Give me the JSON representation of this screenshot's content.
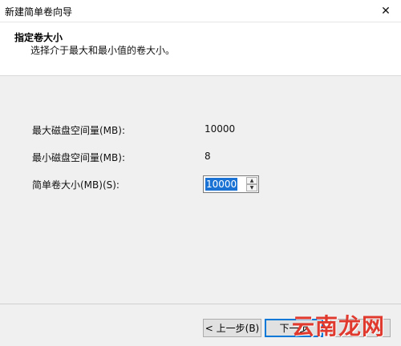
{
  "window": {
    "title": "新建简单卷向导",
    "close_glyph": "✕"
  },
  "header": {
    "step_title": "指定卷大小",
    "step_desc": "选择介于最大和最小值的卷大小。"
  },
  "fields": {
    "max_label": "最大磁盘空间量(MB):",
    "max_value": "10000",
    "min_label": "最小磁盘空间量(MB):",
    "min_value": "8",
    "size_label": "简单卷大小(MB)(S):",
    "size_value": "10000"
  },
  "buttons": {
    "back": "< 上一步(B)",
    "next": "下一步"
  },
  "watermark": "云南龙网",
  "colors": {
    "selection": "#1a73d4",
    "watermark": "#e03a2f"
  }
}
